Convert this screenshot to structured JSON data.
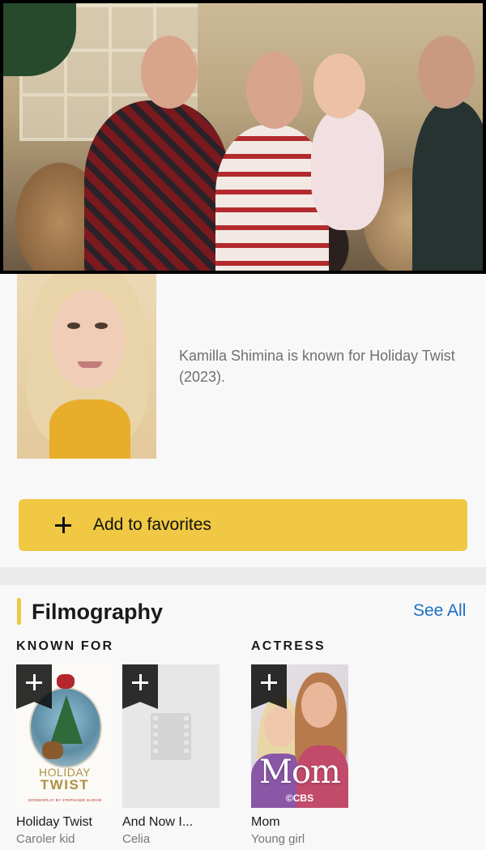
{
  "colors": {
    "accent": "#f0c843",
    "link": "#1e6fc4",
    "background": "#f8f8f8"
  },
  "hero": {
    "content": "video-still"
  },
  "profile": {
    "bio": "Kamilla Shimina is known for Holiday Twist (2023)."
  },
  "favorites": {
    "label": "Add to favorites",
    "icon": "plus-icon"
  },
  "filmography": {
    "title": "Filmography",
    "see_all": "See All",
    "known_for_label": "KNOWN FOR",
    "actress_label": "ACTRESS",
    "items": [
      {
        "title": "Holiday Twist",
        "role": "Caroler kid",
        "poster_line1": "HOLIDAY",
        "poster_line2": "TWIST",
        "poster_credit": "SCREENPLAY BY STEPHANIE GARVIN"
      },
      {
        "title": "And Now I...",
        "role": "Celia"
      },
      {
        "title": "Mom",
        "role": "Young girl",
        "poster_title": "Mom",
        "poster_network": "©CBS"
      }
    ]
  }
}
